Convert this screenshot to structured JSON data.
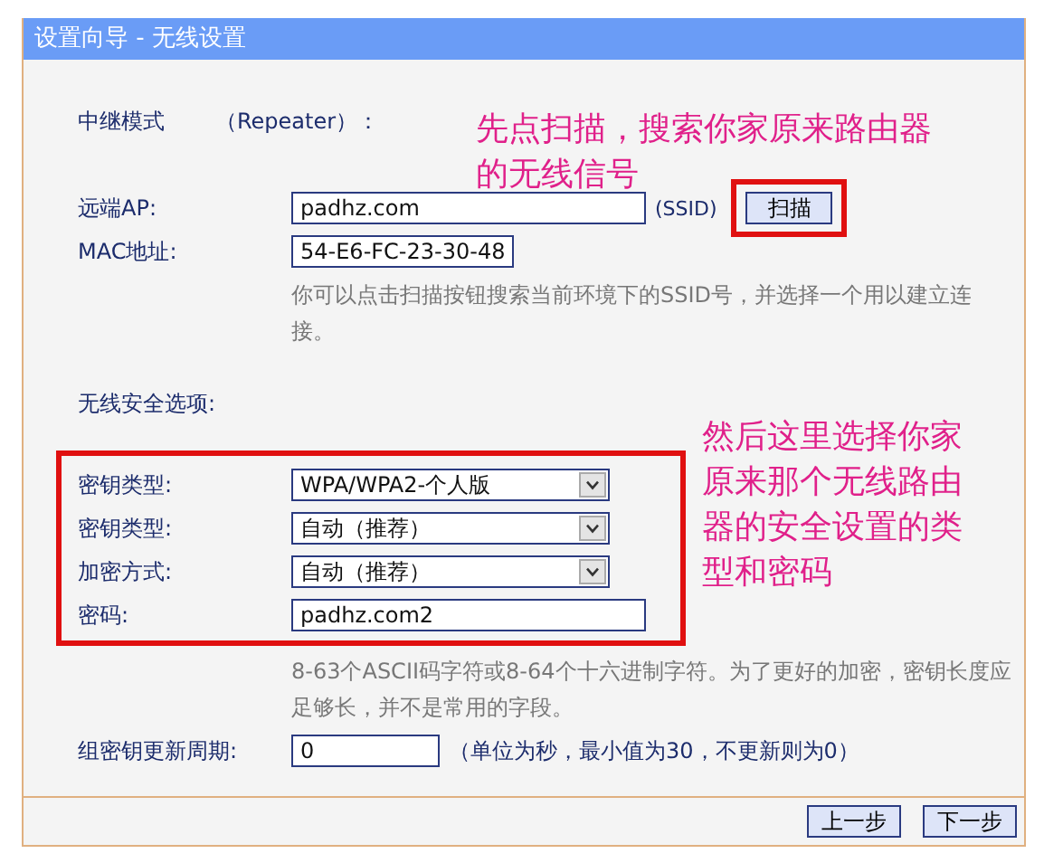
{
  "window": {
    "title": "设置向导 - 无线设置"
  },
  "mode": {
    "label": "中继模式",
    "value": "（Repeater）："
  },
  "annotations": [
    {
      "text": "先点扫描，搜索你家原来路由器的无线信号"
    },
    {
      "text": "然后这里选择你家原来那个无线路由器的安全设置的类型和密码"
    }
  ],
  "remote_ap": {
    "label": "远端AP:",
    "value": "padhz.com",
    "suffix": "(SSID)",
    "button": "扫描"
  },
  "mac": {
    "label": "MAC地址:",
    "value": "54-E6-FC-23-30-48"
  },
  "ap_hint": "你可以点击扫描按钮搜索当前环境下的SSID号，并选择一个用以建立连接。",
  "security_label": "无线安全选项:",
  "security_fields": [
    {
      "kind": "select",
      "label": "密钥类型:",
      "value": "WPA/WPA2-个人版"
    },
    {
      "kind": "select",
      "label": "密钥类型:",
      "value": "自动（推荐）"
    },
    {
      "kind": "select",
      "label": "加密方式:",
      "value": "自动（推荐）"
    },
    {
      "kind": "input",
      "label": "密码:",
      "value": "padhz.com2"
    }
  ],
  "password_hint": "8-63个ASCII码字符或8-64个十六进制字符。为了更好的加密，密钥长度应足够长，并不是常用的字段。",
  "rekey": {
    "label": "组密钥更新周期:",
    "value": "0",
    "note": "（单位为秒，最小值为30，不更新则为0）"
  },
  "buttons": [
    "上一步",
    "下一步"
  ]
}
